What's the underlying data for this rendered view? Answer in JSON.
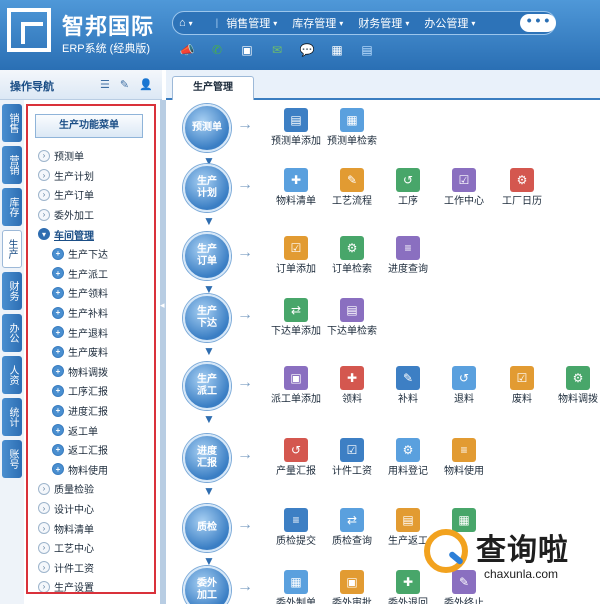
{
  "brand": {
    "name": "智邦国际",
    "subtitle": "ERP系统 (经典版)"
  },
  "top_nav": {
    "home_icon": "home-icon",
    "items": [
      "销售管理",
      "库存管理",
      "财务管理",
      "办公管理"
    ],
    "more": "• • •"
  },
  "quick_tools": [
    "megaphone-icon",
    "phone-icon",
    "window-icon",
    "mail-icon",
    "wechat-icon",
    "grid-icon",
    "document-icon"
  ],
  "left_panel": {
    "title": "操作导航",
    "side_tabs": [
      "销售",
      "营销",
      "库存",
      "生产",
      "财务",
      "办公",
      "人资",
      "统计",
      "账号"
    ],
    "active_side_tab": "生产",
    "menu_title": "生产功能菜单",
    "tree": [
      {
        "label": "预测单",
        "level": 0
      },
      {
        "label": "生产计划",
        "level": 0
      },
      {
        "label": "生产订单",
        "level": 0
      },
      {
        "label": "委外加工",
        "level": 0
      },
      {
        "label": "车间管理",
        "level": 0,
        "open": true
      },
      {
        "label": "生产下达",
        "level": 1
      },
      {
        "label": "生产派工",
        "level": 1
      },
      {
        "label": "生产领料",
        "level": 1
      },
      {
        "label": "生产补料",
        "level": 1
      },
      {
        "label": "生产退料",
        "level": 1
      },
      {
        "label": "生产废料",
        "level": 1
      },
      {
        "label": "物料调拨",
        "level": 1
      },
      {
        "label": "工序汇报",
        "level": 1
      },
      {
        "label": "进度汇报",
        "level": 1
      },
      {
        "label": "返工单",
        "level": 1
      },
      {
        "label": "返工汇报",
        "level": 1
      },
      {
        "label": "物料使用",
        "level": 1
      },
      {
        "label": "质量检验",
        "level": 0
      },
      {
        "label": "设计中心",
        "level": 0
      },
      {
        "label": "物料清单",
        "level": 0
      },
      {
        "label": "工艺中心",
        "level": 0
      },
      {
        "label": "计件工资",
        "level": 0
      },
      {
        "label": "生产设置",
        "level": 0
      }
    ]
  },
  "main": {
    "tab": "生产管理",
    "stages": [
      {
        "label": "预测单",
        "ops": [
          "预测单添加",
          "预测单检索"
        ]
      },
      {
        "label": "生产计划",
        "ops": [
          "物料清单",
          "工艺流程",
          "工序",
          "工作中心",
          "工厂日历"
        ]
      },
      {
        "label": "生产订单",
        "ops": [
          "订单添加",
          "订单检索",
          "进度查询"
        ]
      },
      {
        "label": "生产下达",
        "ops": [
          "下达单添加",
          "下达单检索"
        ]
      },
      {
        "label": "生产派工",
        "ops": [
          "派工单添加",
          "领料",
          "补料",
          "退料",
          "废料",
          "物料调拨"
        ]
      },
      {
        "label": "进度汇报",
        "ops": [
          "产量汇报",
          "计件工资",
          "用料登记",
          "物料使用"
        ]
      },
      {
        "label": "质检",
        "ops": [
          "质检提交",
          "质检查询",
          "生产返工",
          ""
        ]
      },
      {
        "label": "委外加工",
        "ops": [
          "委外制单",
          "委外审批",
          "委外退回",
          "委外终止"
        ]
      }
    ],
    "icon_colors": [
      "#3d7fc4",
      "#5aa0de",
      "#e29b32",
      "#48a66a",
      "#8a6fc0",
      "#d4574f"
    ]
  },
  "watermark": {
    "text": "查询啦",
    "url": "chaxunla.com"
  }
}
